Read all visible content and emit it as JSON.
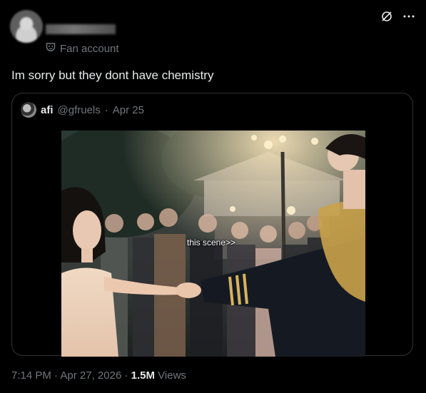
{
  "post": {
    "badge_label": "Fan account",
    "text": "Im sorry but they dont have chemistry"
  },
  "quoted": {
    "name": "afi",
    "handle": "@gfruels",
    "separator": "·",
    "date": "Apr 25",
    "media_caption": "this scene>>"
  },
  "footer": {
    "time": "7:14 PM",
    "dot1": "·",
    "date": "Apr 27, 2026",
    "dot2": "·",
    "views_count": "1.5M",
    "views_label": "Views"
  },
  "icons": {
    "badge": "mask-icon",
    "grok": "grok-icon",
    "more": "more-icon"
  },
  "colors": {
    "background": "#000000",
    "text_primary": "#e7e9ea",
    "text_secondary": "#71767b",
    "border": "#2f3336"
  }
}
